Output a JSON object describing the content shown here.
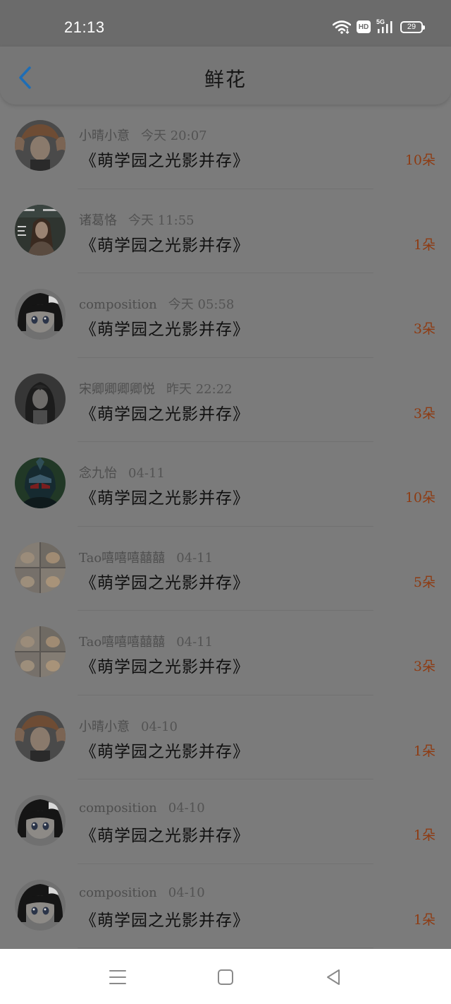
{
  "status_bar": {
    "time": "21:13",
    "hd_label": "HD",
    "network_label": "5G",
    "battery_level": "29",
    "icons": [
      "wifi-icon",
      "hd-icon",
      "signal-5g-icon",
      "battery-icon"
    ]
  },
  "header": {
    "title": "鲜花",
    "back_icon": "chevron-left-icon",
    "accent_color": "#1e6db5"
  },
  "list": {
    "items": [
      {
        "user": "小晴小意",
        "time": "今天 20:07",
        "work": "《萌学园之光影并存》",
        "count": "10朵",
        "avatar": "avatar-brown-hair"
      },
      {
        "user": "诸葛恪",
        "time": "今天 11:55",
        "work": "《萌学园之光影并存》",
        "count": "1朵",
        "avatar": "avatar-poster-woman"
      },
      {
        "user": "composition",
        "time": "今天 05:58",
        "work": "《萌学园之光影并存》",
        "count": "3朵",
        "avatar": "avatar-anime-girl"
      },
      {
        "user": "宋卿卿卿卿悦",
        "time": "昨天 22:22",
        "work": "《萌学园之光影并存》",
        "count": "3朵",
        "avatar": "avatar-dark-portrait"
      },
      {
        "user": "念九怡",
        "time": "04-11",
        "work": "《萌学园之光影并存》",
        "count": "10朵",
        "avatar": "avatar-armored-hero"
      },
      {
        "user": "Tao嘻嘻嘻囍囍",
        "time": "04-11",
        "work": "《萌学园之光影并存》",
        "count": "5朵",
        "avatar": "avatar-cat-grid"
      },
      {
        "user": "Tao嘻嘻嘻囍囍",
        "time": "04-11",
        "work": "《萌学园之光影并存》",
        "count": "3朵",
        "avatar": "avatar-cat-grid"
      },
      {
        "user": "小晴小意",
        "time": "04-10",
        "work": "《萌学园之光影并存》",
        "count": "1朵",
        "avatar": "avatar-brown-hair"
      },
      {
        "user": "composition",
        "time": "04-10",
        "work": "《萌学园之光影并存》",
        "count": "1朵",
        "avatar": "avatar-anime-girl"
      },
      {
        "user": "composition",
        "time": "04-10",
        "work": "《萌学园之光影并存》",
        "count": "1朵",
        "avatar": "avatar-anime-girl"
      }
    ]
  },
  "nav_bar": {
    "icons": [
      "menu-icon",
      "home-square-icon",
      "back-triangle-icon"
    ]
  }
}
